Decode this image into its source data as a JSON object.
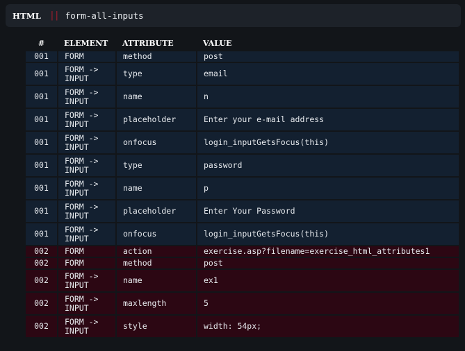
{
  "header": {
    "language": "HTML",
    "separator": "||",
    "title": "form-all-inputs"
  },
  "columns": [
    "#",
    "ELEMENT",
    "ATTRIBUTE",
    "VALUE"
  ],
  "rows": [
    {
      "num": "001",
      "element": "FORM",
      "attribute": "method",
      "value": "post",
      "group": 1
    },
    {
      "num": "001",
      "element": "FORM -> INPUT",
      "attribute": "type",
      "value": "email",
      "group": 1
    },
    {
      "num": "001",
      "element": "FORM -> INPUT",
      "attribute": "name",
      "value": "n",
      "group": 1
    },
    {
      "num": "001",
      "element": "FORM -> INPUT",
      "attribute": "placeholder",
      "value": "Enter your e-mail address",
      "group": 1
    },
    {
      "num": "001",
      "element": "FORM -> INPUT",
      "attribute": "onfocus",
      "value": "login_inputGetsFocus(this)",
      "group": 1
    },
    {
      "num": "001",
      "element": "FORM -> INPUT",
      "attribute": "type",
      "value": "password",
      "group": 1
    },
    {
      "num": "001",
      "element": "FORM -> INPUT",
      "attribute": "name",
      "value": "p",
      "group": 1
    },
    {
      "num": "001",
      "element": "FORM -> INPUT",
      "attribute": "placeholder",
      "value": "Enter Your Password",
      "group": 1
    },
    {
      "num": "001",
      "element": "FORM -> INPUT",
      "attribute": "onfocus",
      "value": "login_inputGetsFocus(this)",
      "group": 1
    },
    {
      "num": "002",
      "element": "FORM",
      "attribute": "action",
      "value": "exercise.asp?filename=exercise_html_attributes1",
      "group": 2
    },
    {
      "num": "002",
      "element": "FORM",
      "attribute": "method",
      "value": "post",
      "group": 2
    },
    {
      "num": "002",
      "element": "FORM -> INPUT",
      "attribute": "name",
      "value": "ex1",
      "group": 2
    },
    {
      "num": "002",
      "element": "FORM -> INPUT",
      "attribute": "maxlength",
      "value": "5",
      "group": 2
    },
    {
      "num": "002",
      "element": "FORM -> INPUT",
      "attribute": "style",
      "value": "width: 54px;",
      "group": 2
    }
  ],
  "colors": {
    "group1_row": "#132030",
    "group2_row": "#2c0713",
    "separator": "#a51d2d",
    "header_bar": "#1d2229"
  }
}
